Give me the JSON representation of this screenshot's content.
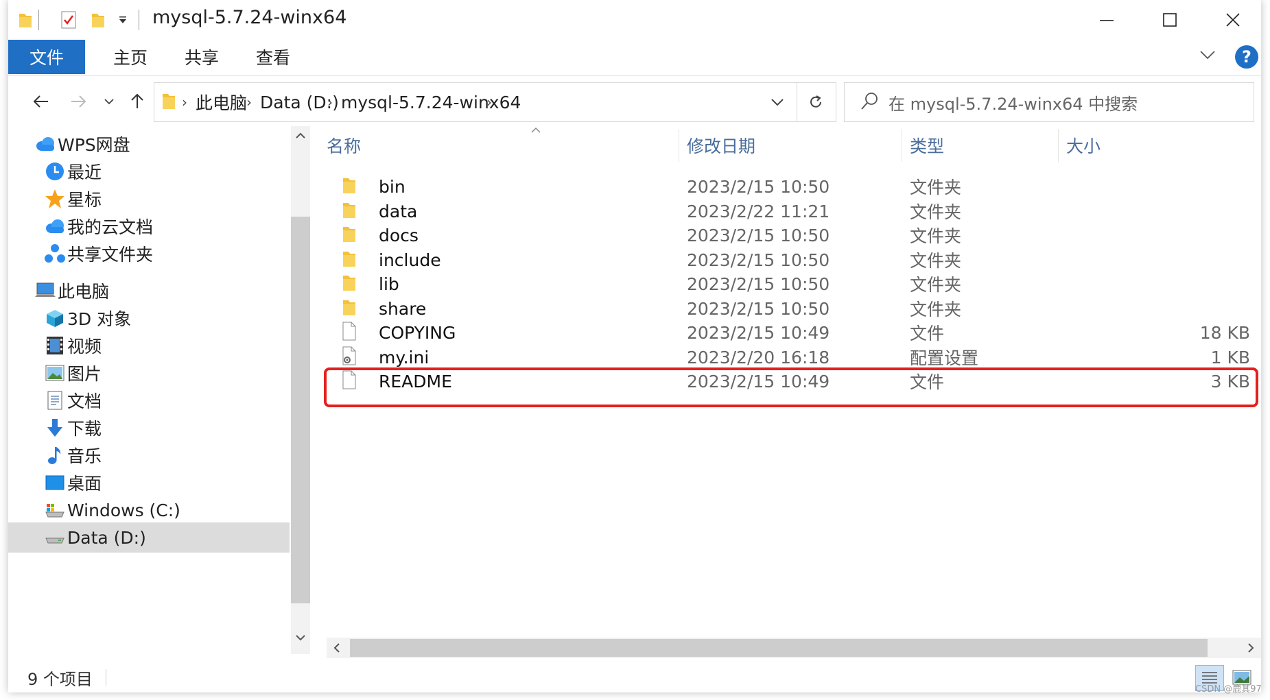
{
  "window": {
    "title": "mysql-5.7.24-winx64"
  },
  "ribbon": {
    "tabs": [
      {
        "label": "文件",
        "active": true
      },
      {
        "label": "主页"
      },
      {
        "label": "共享"
      },
      {
        "label": "查看"
      }
    ],
    "help_label": "?"
  },
  "address": {
    "crumbs": [
      "此电脑",
      "Data (D:)",
      "mysql-5.7.24-winx64"
    ]
  },
  "search": {
    "placeholder": "在 mysql-5.7.24-winx64 中搜索"
  },
  "sidebar": {
    "items": [
      {
        "label": "WPS网盘",
        "icon": "cloud-icon"
      },
      {
        "label": "最近",
        "icon": "clock-icon"
      },
      {
        "label": "星标",
        "icon": "star-icon"
      },
      {
        "label": "我的云文档",
        "icon": "cloud-doc-icon"
      },
      {
        "label": "共享文件夹",
        "icon": "share-folder-icon"
      },
      {
        "label": "此电脑",
        "icon": "computer-icon"
      },
      {
        "label": "3D 对象",
        "icon": "cube-icon"
      },
      {
        "label": "视频",
        "icon": "video-icon"
      },
      {
        "label": "图片",
        "icon": "picture-icon"
      },
      {
        "label": "文档",
        "icon": "document-icon"
      },
      {
        "label": "下载",
        "icon": "download-icon"
      },
      {
        "label": "音乐",
        "icon": "music-icon"
      },
      {
        "label": "桌面",
        "icon": "desktop-icon"
      },
      {
        "label": "Windows (C:)",
        "icon": "drive-c-icon"
      },
      {
        "label": "Data (D:)",
        "icon": "drive-d-icon",
        "selected": true
      }
    ]
  },
  "columns": {
    "name": "名称",
    "date": "修改日期",
    "type": "类型",
    "size": "大小"
  },
  "files": [
    {
      "name": "bin",
      "date": "2023/2/15 10:50",
      "type": "文件夹",
      "size": "",
      "icon": "folder-icon"
    },
    {
      "name": "data",
      "date": "2023/2/22 11:21",
      "type": "文件夹",
      "size": "",
      "icon": "folder-icon"
    },
    {
      "name": "docs",
      "date": "2023/2/15 10:50",
      "type": "文件夹",
      "size": "",
      "icon": "folder-icon"
    },
    {
      "name": "include",
      "date": "2023/2/15 10:50",
      "type": "文件夹",
      "size": "",
      "icon": "folder-icon"
    },
    {
      "name": "lib",
      "date": "2023/2/15 10:50",
      "type": "文件夹",
      "size": "",
      "icon": "folder-icon"
    },
    {
      "name": "share",
      "date": "2023/2/15 10:50",
      "type": "文件夹",
      "size": "",
      "icon": "folder-icon"
    },
    {
      "name": "COPYING",
      "date": "2023/2/15 10:49",
      "type": "文件",
      "size": "18 KB",
      "icon": "file-icon"
    },
    {
      "name": "my.ini",
      "date": "2023/2/20 16:18",
      "type": "配置设置",
      "size": "1 KB",
      "icon": "config-file-icon",
      "highlighted": true
    },
    {
      "name": "README",
      "date": "2023/2/15 10:49",
      "type": "文件",
      "size": "3 KB",
      "icon": "file-icon"
    }
  ],
  "status": {
    "count": "9 个项目"
  },
  "watermark": "CSDN @鹿其97",
  "colors": {
    "accent": "#1f6fc5",
    "highlight_border": "#e4201e",
    "folder": "#f3c13a"
  }
}
